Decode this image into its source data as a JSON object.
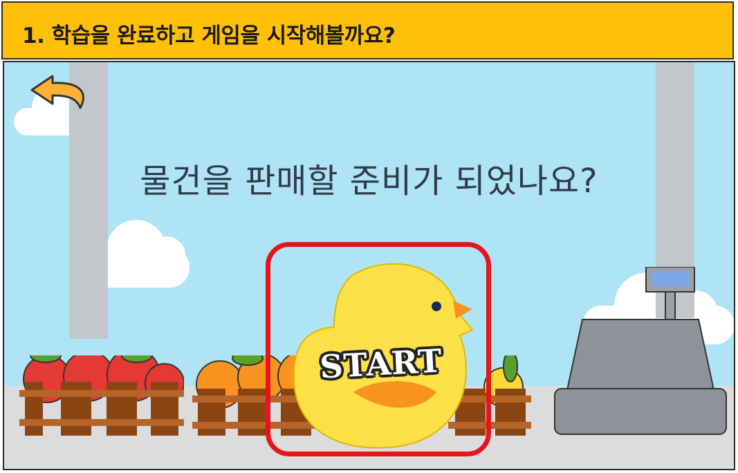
{
  "header": {
    "title": "1. 학습을 완료하고 게임을 시작해볼까요?"
  },
  "scene": {
    "question": "물건을 판매할 준비가 되었나요?",
    "start_label": "START",
    "back_icon": "back-arrow-icon",
    "colors": {
      "sky": "#aee4f5",
      "header": "#ffc107",
      "highlight": "#e8141b",
      "chick": "#fde047",
      "beak": "#f7931e"
    }
  }
}
